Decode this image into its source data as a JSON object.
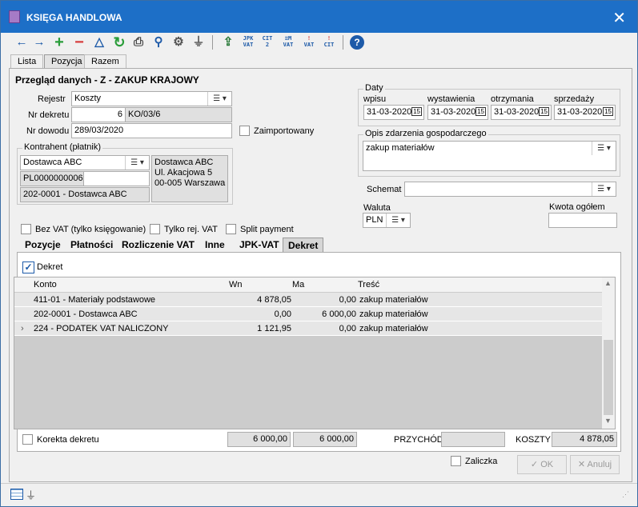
{
  "window": {
    "title": "KSIĘGA HANDLOWA",
    "close_glyph": "✕"
  },
  "toolbar": {
    "icons": [
      "arrow-left-icon",
      "arrow-right-icon",
      "add-icon",
      "remove-icon",
      "triangle-icon",
      "refresh-icon",
      "print-icon",
      "search-icon",
      "settings-icon",
      "filter-icon",
      "export-icon",
      "jpk-vat-icon",
      "cit-2-icon",
      "zm-vat-icon",
      "vat-report-icon",
      "cit-report-icon",
      "help-icon"
    ],
    "glyphs": {
      "back": "←",
      "forward": "→",
      "add": "+",
      "remove": "−",
      "triangle": "△",
      "refresh": "↻",
      "print": "⎙",
      "search": "⚲",
      "settings": "⚙",
      "filter": "⏚",
      "export": "⇪",
      "help": "?"
    },
    "jpk_top": "JPK",
    "jpk_bottom": "VAT",
    "cit2_top": "CIT",
    "cit2_bottom": "2",
    "zm_top": "≡M",
    "zm_bottom": "VAT",
    "v_top": "!",
    "v_bottom": "VAT",
    "c_top": "!",
    "c_bottom": "CIT"
  },
  "main_tabs": [
    "Lista",
    "Pozycja",
    "Razem"
  ],
  "section_title": "Przegląd danych - Z - ZAKUP KRAJOWY",
  "rejestr": {
    "label": "Rejestr",
    "value": "Koszty"
  },
  "nr_dekretu": {
    "label": "Nr dekretu",
    "number": "6",
    "code": "KO/03/6"
  },
  "nr_dowodu": {
    "label": "Nr dowodu",
    "value": "289/03/2020"
  },
  "zaimportowany": {
    "label": "Zaimportowany",
    "checked": false
  },
  "kontrahent": {
    "group_label": "Kontrahent (płatnik)",
    "name": "Dostawca ABC",
    "nip": "PL0000000006",
    "account": "202-0001 - Dostawca ABC",
    "address_name": "Dostawca ABC",
    "address_street": "Ul. Akacjowa 5",
    "address_city": "00-005 Warszawa"
  },
  "daty": {
    "group_label": "Daty",
    "labels": [
      "wpisu",
      "wystawienia",
      "otrzymania",
      "sprzedaży"
    ],
    "values": [
      "31-03-2020",
      "31-03-2020",
      "31-03-2020",
      "31-03-2020"
    ],
    "cal_glyph": "15"
  },
  "opis": {
    "group_label": "Opis zdarzenia gospodarczego",
    "value": "zakup materiałów"
  },
  "schemat": {
    "label": "Schemat",
    "value": ""
  },
  "waluta": {
    "label": "Waluta",
    "value": "PLN"
  },
  "kwota": {
    "label": "Kwota ogółem",
    "value": ""
  },
  "checkboxes": {
    "bez_vat": "Bez VAT (tylko księgowanie)",
    "tylko_rej": "Tylko rej. VAT",
    "split": "Split payment"
  },
  "sub_tabs": [
    "Pozycje",
    "Płatności",
    "Rozliczenie VAT",
    "Inne",
    "JPK-VAT",
    "Dekret"
  ],
  "dekret_check": {
    "label": "Dekret",
    "checked": true
  },
  "grid": {
    "headers": [
      "Konto",
      "Wn",
      "Ma",
      "Treść"
    ],
    "rows": [
      {
        "konto": "411-01 - Materiały podstawowe",
        "wn": "4 878,05",
        "ma": "0,00",
        "tresc": "zakup materiałów"
      },
      {
        "konto": "202-0001 - Dostawca ABC",
        "wn": "0,00",
        "ma": "6 000,00",
        "tresc": "zakup materiałów"
      },
      {
        "konto": "224 - PODATEK VAT NALICZONY",
        "wn": "1 121,95",
        "ma": "0,00",
        "tresc": "zakup materiałów"
      }
    ]
  },
  "totals": {
    "korekta_label": "Korekta dekretu",
    "wn_sum": "6 000,00",
    "ma_sum": "6 000,00",
    "przychod_label": "PRZYCHÓD",
    "przychod_value": "",
    "koszty_label": "KOSZTY",
    "koszty_value": "4 878,05"
  },
  "zaliczka": {
    "label": "Zaliczka",
    "checked": false
  },
  "buttons": {
    "ok": "OK",
    "anuluj": "Anuluj"
  }
}
